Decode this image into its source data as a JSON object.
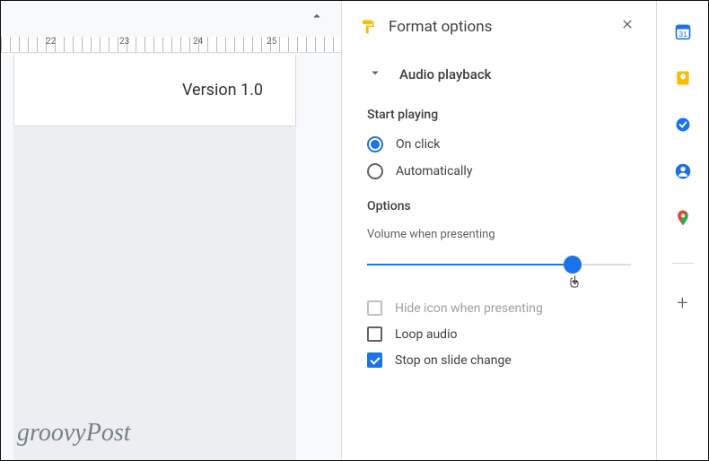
{
  "canvas": {
    "ruler_marks": [
      "22",
      "23",
      "24",
      "25"
    ],
    "version_label": "Version 1.0"
  },
  "panel": {
    "title": "Format options",
    "section_title": "Audio playback",
    "start_playing_heading": "Start playing",
    "radio_on_click": "On click",
    "radio_automatically": "Automatically",
    "options_heading": "Options",
    "volume_hint": "Volume when presenting",
    "cb_hide_icon": "Hide icon when presenting",
    "cb_loop_audio": "Loop audio",
    "cb_stop_change": "Stop on slide change",
    "slider_value": 78
  },
  "watermark": "groovyPost"
}
